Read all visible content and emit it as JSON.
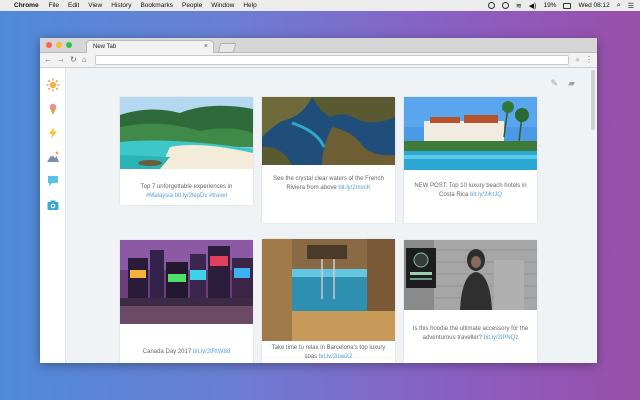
{
  "menubar": {
    "app": "Chrome",
    "items": [
      "File",
      "Edit",
      "View",
      "History",
      "Bookmarks",
      "People",
      "Window",
      "Help"
    ],
    "battery": "19%",
    "clock": "Wed 08:12"
  },
  "window": {
    "tab_title": "New Tab",
    "tab_close": "×",
    "address_value": ""
  },
  "sidebar": {
    "icons": [
      "sun-icon",
      "ice-cream-icon",
      "lightning-icon",
      "mountain-icon",
      "chat-icon",
      "camera-icon"
    ]
  },
  "feed": {
    "cards": [
      {
        "text": "Top 7 unforgettable experiences in ",
        "link": "#Malaysia bit.ly/2lepDv #travel"
      },
      {
        "text": "See the crystal clear waters of the French Riviera from above ",
        "link": "bit.ly/2mvcK"
      },
      {
        "text": "NEW POST: Top 10 luxury beach hotels in Costa Rica ",
        "link": "bit.ly/2iKtJQ"
      },
      {
        "text": "Take time to relax in Barcelona's top luxury spas ",
        "link": "bit.ly/2lpwX2"
      },
      {
        "text": "Canada Day 2017 ",
        "link": "bit.ly/2tRtW8d"
      },
      {
        "text": "Is this hoodie the ultimate accessory for the adventurous traveller? ",
        "link": "bit.ly/2lPNQz"
      }
    ]
  },
  "colors": {
    "accent_link": "#5aa0d8",
    "red": "#ff5f57",
    "yellow": "#febc2e",
    "green": "#28c840"
  }
}
